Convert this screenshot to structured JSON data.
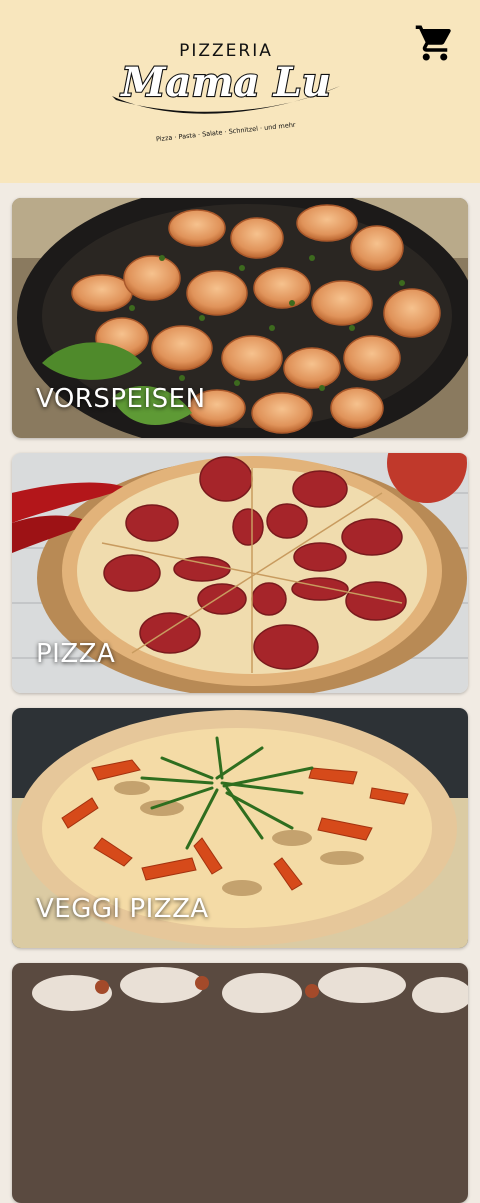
{
  "header": {
    "logo": {
      "top_text": "PIZZERIA",
      "main_text": "Mama Lu",
      "tagline": "Pizza · Pasta · Salate · Schnitzel · und mehr"
    },
    "cart_icon": "shopping-cart-icon",
    "background_color": "#f8e6bd"
  },
  "categories": [
    {
      "label": "VORSPEISEN"
    },
    {
      "label": "PIZZA"
    },
    {
      "label": "VEGGI PIZZA"
    },
    {
      "label": ""
    }
  ]
}
